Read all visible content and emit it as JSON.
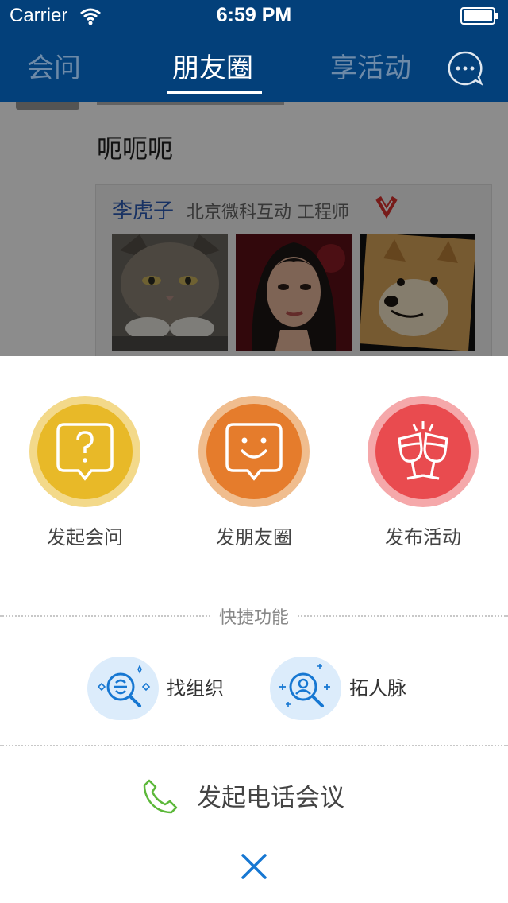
{
  "status_bar": {
    "carrier": "Carrier",
    "time": "6:59 PM"
  },
  "nav": {
    "tabs": [
      {
        "label": "会问",
        "active": false
      },
      {
        "label": "朋友圈",
        "active": true
      },
      {
        "label": "享活动",
        "active": false
      }
    ],
    "message_icon": "chat-bubble-icon"
  },
  "feed": {
    "post_text": "呃呃呃",
    "shared_card": {
      "name": "李虎子",
      "company_title": "北京微科互动  工程师",
      "badge_icon": "verified-v-icon",
      "photos": [
        "cat-photo",
        "woman-photo",
        "dog-photo"
      ]
    }
  },
  "sheet": {
    "actions": [
      {
        "label": "发起会问",
        "icon": "question-bubble-icon",
        "color": "#e8b928"
      },
      {
        "label": "发朋友圈",
        "icon": "smile-bubble-icon",
        "color": "#e57c2c"
      },
      {
        "label": "发布活动",
        "icon": "cheers-glasses-icon",
        "color": "#e94b4f"
      }
    ],
    "quick_title": "快捷功能",
    "quick": [
      {
        "label": "找组织",
        "icon": "find-org-icon"
      },
      {
        "label": "拓人脉",
        "icon": "find-people-icon"
      }
    ],
    "call": {
      "label": "发起电话会议",
      "icon": "phone-icon",
      "color": "#5cb83a"
    },
    "close_icon": "close-icon"
  },
  "colors": {
    "nav_bg": "#03407a",
    "accent_blue": "#1677d2"
  }
}
